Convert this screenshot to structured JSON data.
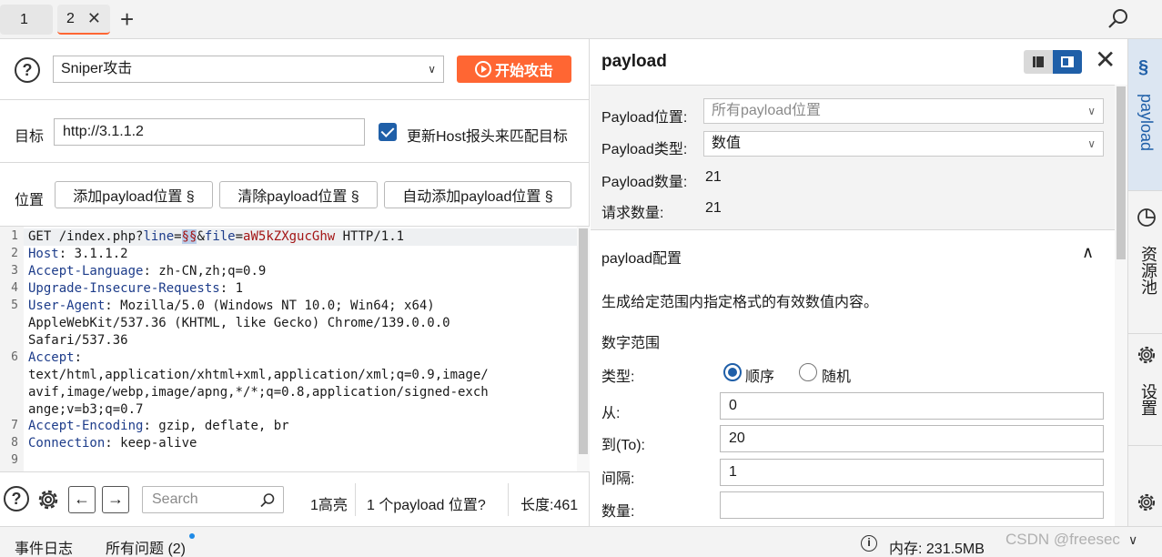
{
  "tabs": [
    {
      "label": "1"
    },
    {
      "label": "2",
      "close": "✕"
    }
  ],
  "left": {
    "attack_type": "Sniper攻击",
    "start_attack": "开始攻击",
    "target_label": "目标",
    "target_value": "http://3.1.1.2",
    "update_host_label": "更新Host报头来匹配目标",
    "position_label": "位置",
    "add_btn": "添加payload位置 §",
    "clear_btn": "清除payload位置 §",
    "auto_btn": "自动添加payload位置 §",
    "request": {
      "l1_method": "GET /index.php?",
      "l1_p1": "line",
      "l1_eq1": "=",
      "l1_marker": "§§",
      "l1_amp": "&",
      "l1_p2": "file",
      "l1_eq2": "=",
      "l1_v2": "aW5kZXgucGhw",
      "l1_tail": " HTTP/1.1",
      "l2_k": "Host",
      "l2_v": ": 3.1.1.2",
      "l3_k": "Accept-Language",
      "l3_v": ": zh-CN,zh;q=0.9",
      "l4_k": "Upgrade-Insecure-Requests",
      "l4_v": ": 1",
      "l5_k": "User-Agent",
      "l5_v": ": Mozilla/5.0 (Windows NT 10.0; Win64; x64)",
      "l5_c1": "AppleWebKit/537.36 (KHTML, like Gecko) Chrome/139.0.0.0",
      "l5_c2": "Safari/537.36",
      "l6_k": "Accept",
      "l6_v": ":",
      "l6_c1": "text/html,application/xhtml+xml,application/xml;q=0.9,image/",
      "l6_c2": "avif,image/webp,image/apng,*/*;q=0.8,application/signed-exch",
      "l6_c3": "ange;v=b3;q=0.7",
      "l7_k": "Accept-Encoding",
      "l7_v": ": gzip, deflate, br",
      "l8_k": "Connection",
      "l8_v": ": keep-alive",
      "line_numbers": [
        "1",
        "2",
        "3",
        "4",
        "5",
        "6",
        "7",
        "8",
        "9"
      ]
    },
    "search_placeholder": "Search",
    "highlight_count": "1高亮",
    "payload_positions": "1 个payload 位置?",
    "length": "长度:461"
  },
  "right": {
    "title": "payload",
    "position_label": "Payload位置:",
    "position_value": "所有payload位置",
    "type_label": "Payload类型:",
    "type_value": "数值",
    "count_label": "Payload数量:",
    "count_value": "21",
    "req_label": "请求数量:",
    "req_value": "21",
    "config_title": "payload配置",
    "config_desc": "生成给定范围内指定格式的有效数值内容。",
    "range_title": "数字范围",
    "kind_label": "类型:",
    "seq_label": "顺序",
    "rand_label": "随机",
    "from_label": "从:",
    "from_value": "0",
    "to_label": "到(To):",
    "to_value": "20",
    "step_label": "间隔:",
    "step_value": "1",
    "qty_label": "数量:",
    "qty_value": ""
  },
  "strip": {
    "payload": "payload",
    "resource_pool": "资源池",
    "settings": "设置"
  },
  "status": {
    "event_log": "事件日志",
    "all_issues": "所有问题 (2)",
    "memory": "内存: 231.5MB",
    "watermark": "CSDN @freesec"
  },
  "colors": {
    "accent": "#ff6633",
    "blue": "#1f5fa8",
    "key": "#1d3c8a",
    "value": "#a31515"
  }
}
